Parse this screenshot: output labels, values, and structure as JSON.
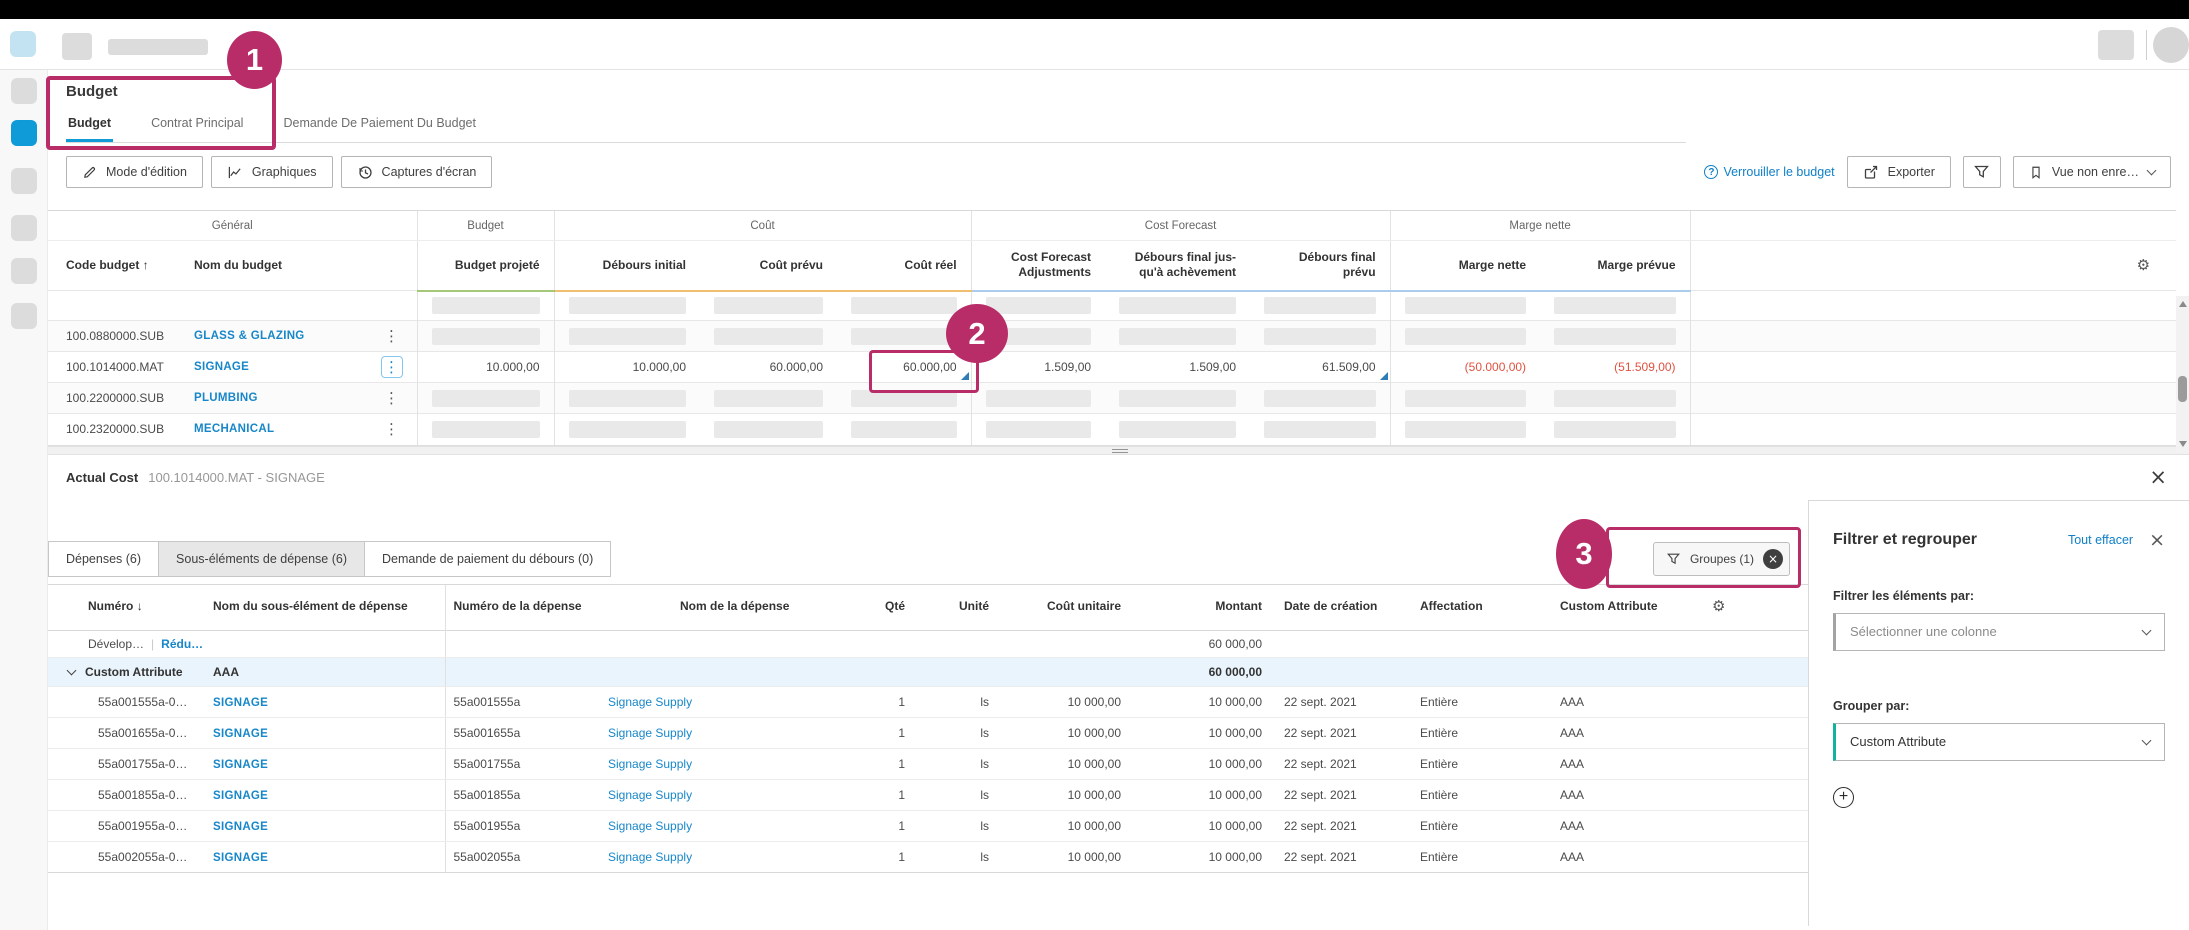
{
  "colors": {
    "accent_blue": "#0f9bd7",
    "link_blue": "#1787c9",
    "annotation_pink": "#b82d68",
    "negative_red": "#e05140",
    "teal_accent": "#12b2a0"
  },
  "page": {
    "title": "Budget",
    "tabs": [
      {
        "label": "Budget",
        "active": true
      },
      {
        "label": "Contrat Principal",
        "active": false
      },
      {
        "label": "Demande De Paiement Du Budget",
        "active": false
      }
    ]
  },
  "toolbar": {
    "edit_mode": "Mode d'édition",
    "charts": "Graphiques",
    "screenshots": "Captures d'écran",
    "lock_budget": "Verrouiller le budget",
    "export": "Exporter",
    "view": "Vue non enre…"
  },
  "main_table": {
    "groups": [
      "Général",
      "Budget",
      "Coût",
      "Cost Forecast",
      "Marge nette"
    ],
    "columns": [
      "Code budget",
      "Nom du budget",
      "Budget projeté",
      "Débours initial",
      "Coût prévu",
      "Coût réel",
      "Cost Forecast Adjustments",
      "Débours final jus-qu'à achèvement",
      "Débours final prévu",
      "Marge nette",
      "Marge prévue"
    ],
    "sort_column": "Code budget",
    "rows": [
      {
        "type": "placeholder",
        "code": "100.0880000.SUB",
        "name": "GLASS & GLAZING"
      },
      {
        "type": "selected",
        "code": "100.1014000.MAT",
        "name": "SIGNAGE",
        "v0": "10.000,00",
        "v1": "10.000,00",
        "v2": "60.000,00",
        "v3": "60.000,00",
        "v4": "1.509,00",
        "v5": "1.509,00",
        "v6": "61.509,00",
        "n0": "(50.000,00)",
        "n1": "(51.509,00)"
      },
      {
        "type": "placeholder",
        "code": "100.2200000.SUB",
        "name": "PLUMBING"
      },
      {
        "type": "placeholder",
        "code": "100.2320000.SUB",
        "name": "MECHANICAL"
      }
    ]
  },
  "detail": {
    "title": "Actual Cost",
    "subtitle": "100.1014000.MAT - SIGNAGE",
    "tabs": [
      {
        "label": "Dépenses (6)",
        "active": false
      },
      {
        "label": "Sous-éléments de dépense (6)",
        "active": true
      },
      {
        "label": "Demande de paiement du débours (0)",
        "active": false
      }
    ],
    "groups_button": "Groupes (1)",
    "table": {
      "columns": [
        "Numéro",
        "Nom du sous-élément de dépense",
        "Numéro de la dépense",
        "Nom de la dépense",
        "Qté",
        "Unité",
        "Coût unitaire",
        "Montant",
        "Date de création",
        "Affectation",
        "Custom Attribute"
      ],
      "expand_label": "Dévelop…",
      "collapse_label": "Rédu…",
      "summary_total": "60 000,00",
      "group": {
        "label": "Custom Attribute",
        "value": "AAA",
        "total": "60 000,00"
      },
      "rows": [
        {
          "numero": "55a001555a-0…",
          "sub_name": "SIGNAGE",
          "exp_num": "55a001555a",
          "exp_name": "Signage Supply",
          "qty": "1",
          "unit": "ls",
          "unit_cost": "10 000,00",
          "amount": "10 000,00",
          "created": "22 sept. 2021",
          "allocation": "Entière",
          "custom": "AAA"
        },
        {
          "numero": "55a001655a-0…",
          "sub_name": "SIGNAGE",
          "exp_num": "55a001655a",
          "exp_name": "Signage Supply",
          "qty": "1",
          "unit": "ls",
          "unit_cost": "10 000,00",
          "amount": "10 000,00",
          "created": "22 sept. 2021",
          "allocation": "Entière",
          "custom": "AAA"
        },
        {
          "numero": "55a001755a-0…",
          "sub_name": "SIGNAGE",
          "exp_num": "55a001755a",
          "exp_name": "Signage Supply",
          "qty": "1",
          "unit": "ls",
          "unit_cost": "10 000,00",
          "amount": "10 000,00",
          "created": "22 sept. 2021",
          "allocation": "Entière",
          "custom": "AAA"
        },
        {
          "numero": "55a001855a-0…",
          "sub_name": "SIGNAGE",
          "exp_num": "55a001855a",
          "exp_name": "Signage Supply",
          "qty": "1",
          "unit": "ls",
          "unit_cost": "10 000,00",
          "amount": "10 000,00",
          "created": "22 sept. 2021",
          "allocation": "Entière",
          "custom": "AAA"
        },
        {
          "numero": "55a001955a-0…",
          "sub_name": "SIGNAGE",
          "exp_num": "55a001955a",
          "exp_name": "Signage Supply",
          "qty": "1",
          "unit": "ls",
          "unit_cost": "10 000,00",
          "amount": "10 000,00",
          "created": "22 sept. 2021",
          "allocation": "Entière",
          "custom": "AAA"
        },
        {
          "numero": "55a002055a-0…",
          "sub_name": "SIGNAGE",
          "exp_num": "55a002055a",
          "exp_name": "Signage Supply",
          "qty": "1",
          "unit": "ls",
          "unit_cost": "10 000,00",
          "amount": "10 000,00",
          "created": "22 sept. 2021",
          "allocation": "Entière",
          "custom": "AAA"
        }
      ]
    }
  },
  "filter_panel": {
    "title": "Filtrer et regrouper",
    "clear_all": "Tout effacer",
    "filter_label": "Filtrer les éléments par:",
    "filter_placeholder": "Sélectionner une colonne",
    "group_label": "Grouper par:",
    "group_value": "Custom Attribute"
  },
  "annotations": {
    "step1": "1",
    "step2": "2",
    "step3": "3"
  }
}
